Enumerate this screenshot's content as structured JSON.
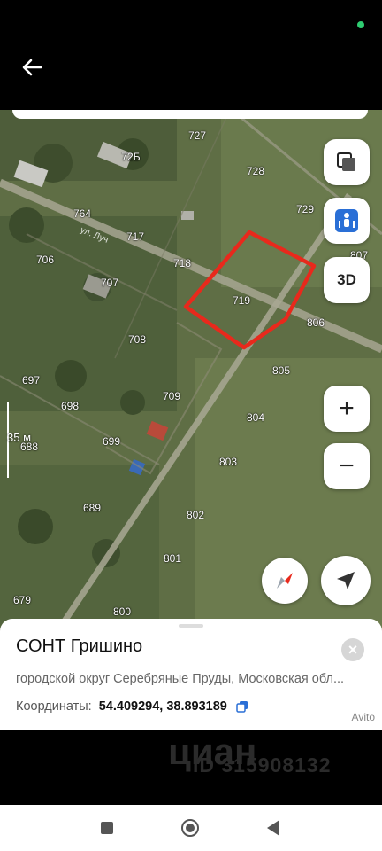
{
  "map": {
    "plot_labels": [
      "727",
      "72Б",
      "728",
      "729",
      "764",
      "717",
      "718",
      "807",
      "706",
      "707",
      "719",
      "806",
      "708",
      "697",
      "805",
      "709",
      "698",
      "804",
      "688",
      "699",
      "803",
      "689",
      "802",
      "801",
      "679",
      "800"
    ],
    "street_label": "ул. Луч",
    "scale_label": "35 м",
    "highlight_color": "#e8291c"
  },
  "controls": {
    "layers_icon": "layers-icon",
    "panorama_icon": "panorama-person-icon",
    "btn_3d": "3D",
    "zoom_in": "+",
    "zoom_out": "−",
    "compass_icon": "compass-icon",
    "locate_icon": "locate-arrow-icon"
  },
  "place": {
    "title": "СОНТ Гришино",
    "address": "городской округ Серебряные Пруды, Московская обл...",
    "coords_label": "Координаты:",
    "coords_value": "54.409294, 38.893189",
    "close": "×"
  },
  "watermark": {
    "brand": "циан",
    "id": "ID 315908132",
    "avito": "Avito"
  }
}
